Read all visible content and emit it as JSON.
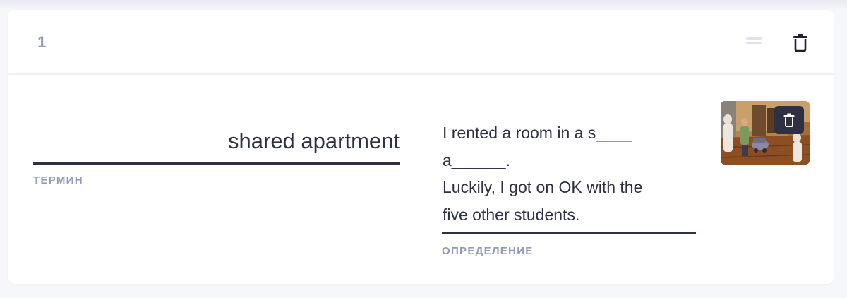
{
  "card": {
    "number": "1",
    "icons": {
      "drag": "drag-handle-icon",
      "delete": "trash-icon"
    },
    "term": {
      "value": "shared apartment",
      "label": "ТЕРМИН"
    },
    "definition": {
      "value": "I rented a room in a s____\na______.\nLuckily, I got on OK with the\nfive other students.",
      "label": "ОПРЕДЕЛЕНИЕ"
    },
    "image": {
      "icon": "apartment-illustration-icon",
      "delete_icon": "trash-icon"
    }
  },
  "colors": {
    "background": "#f6f7fb",
    "card": "#ffffff",
    "text": "#2e3142",
    "label": "#939bb4",
    "handle": "#dfe2ea",
    "image_button": "#2e3142"
  }
}
